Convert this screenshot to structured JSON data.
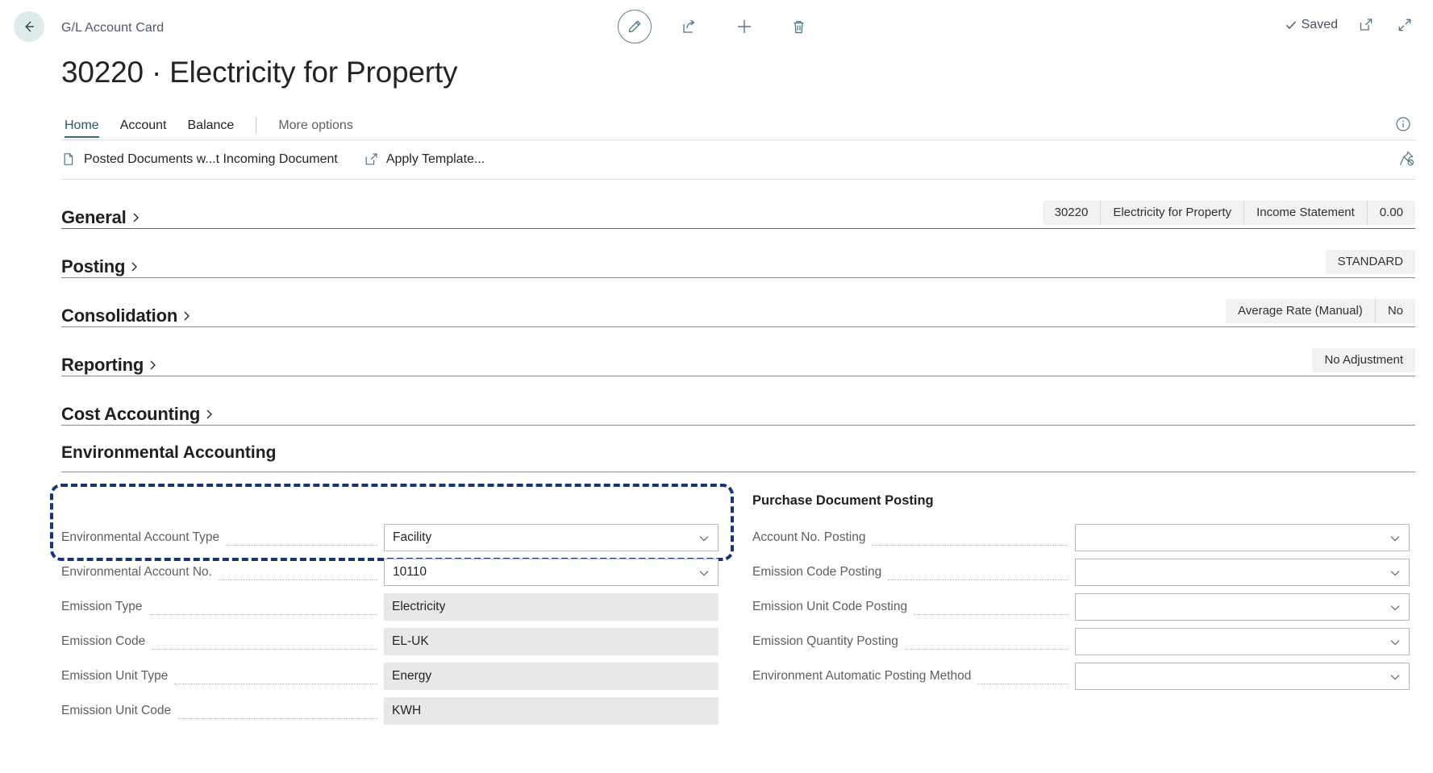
{
  "window": {
    "breadcrumb": "G/L Account Card",
    "title": "30220 · Electricity for Property",
    "save_status": "Saved"
  },
  "toolbar": {
    "back_icon": "back-arrow-icon",
    "edit_icon": "pencil-edit-icon",
    "share_icon": "share-icon",
    "new_icon": "plus-icon",
    "delete_icon": "trash-delete-icon",
    "open_new_window_icon": "open-in-new-window-icon",
    "collapse_icon": "collapse-icon"
  },
  "tabs": [
    {
      "label": "Home",
      "active": true
    },
    {
      "label": "Account",
      "active": false
    },
    {
      "label": "Balance",
      "active": false
    },
    {
      "label": "More options",
      "active": false,
      "muted": true
    }
  ],
  "ribbon": {
    "items": [
      {
        "label": "Posted Documents w...t Incoming Document",
        "icon": "document-icon"
      },
      {
        "label": "Apply Template...",
        "icon": "apply-template-icon"
      }
    ],
    "pin_icon": "unpin-icon",
    "info_icon": "info-icon"
  },
  "sections": [
    {
      "title": "General",
      "collapsed": true,
      "chips": [
        "30220",
        "Electricity for Property",
        "Income Statement",
        "0.00"
      ]
    },
    {
      "title": "Posting",
      "collapsed": true,
      "chips": [
        "STANDARD"
      ]
    },
    {
      "title": "Consolidation",
      "collapsed": true,
      "chips": [
        "Average Rate (Manual)",
        "No"
      ]
    },
    {
      "title": "Reporting",
      "collapsed": true,
      "chips": [
        "No Adjustment"
      ]
    },
    {
      "title": "Cost Accounting",
      "collapsed": true,
      "chips": []
    }
  ],
  "environmental": {
    "title": "Environmental Accounting",
    "left_fields": [
      {
        "label": "Environmental Account Type",
        "value": "Facility",
        "type": "dropdown",
        "highlighted": true
      },
      {
        "label": "Environmental Account No.",
        "value": "10110",
        "type": "dropdown",
        "highlighted": true
      },
      {
        "label": "Emission Type",
        "value": "Electricity",
        "type": "readonly"
      },
      {
        "label": "Emission Code",
        "value": "EL-UK",
        "type": "readonly"
      },
      {
        "label": "Emission Unit Type",
        "value": "Energy",
        "type": "readonly"
      },
      {
        "label": "Emission Unit Code",
        "value": "KWH",
        "type": "readonly"
      }
    ],
    "right_group_title": "Purchase Document Posting",
    "right_fields": [
      {
        "label": "Account No. Posting",
        "value": "",
        "type": "dropdown"
      },
      {
        "label": "Emission Code Posting",
        "value": "",
        "type": "dropdown"
      },
      {
        "label": "Emission Unit Code Posting",
        "value": "",
        "type": "dropdown"
      },
      {
        "label": "Emission Quantity Posting",
        "value": "",
        "type": "dropdown"
      },
      {
        "label": "Environment Automatic Posting Method",
        "value": "",
        "type": "dropdown"
      }
    ]
  },
  "colors": {
    "accent": "#2b5a66",
    "highlight_border": "#17337a",
    "readonly_bg": "#e9e8e7",
    "chip_bg": "#f3f2f1"
  }
}
